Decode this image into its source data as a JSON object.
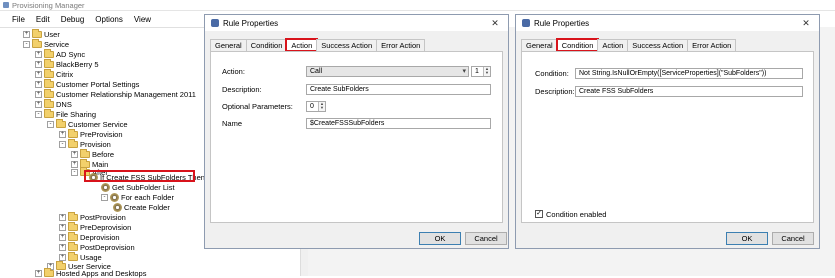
{
  "window": {
    "title": "Provisioning Manager"
  },
  "menu": [
    "File",
    "Edit",
    "Debug",
    "Options",
    "View"
  ],
  "tree": [
    {
      "label": "User",
      "icon": "folder-icon",
      "exp": "+"
    },
    {
      "label": "Service",
      "icon": "folder-icon",
      "exp": "-"
    },
    {
      "label": "AD Sync",
      "icon": "folder-icon",
      "exp": "+"
    },
    {
      "label": "BlackBerry 5",
      "icon": "folder-icon",
      "exp": "+"
    },
    {
      "label": "Citrix",
      "icon": "folder-icon",
      "exp": "+"
    },
    {
      "label": "Customer Portal Settings",
      "icon": "folder-icon",
      "exp": "+"
    },
    {
      "label": "Customer Relationship Management 2011",
      "icon": "folder-icon",
      "exp": "+"
    },
    {
      "label": "DNS",
      "icon": "folder-icon",
      "exp": "+"
    },
    {
      "label": "File Sharing",
      "icon": "folder-icon",
      "exp": "-"
    },
    {
      "label": "Customer Service",
      "icon": "folder-icon",
      "exp": "-"
    },
    {
      "label": "PreProvision",
      "icon": "folder-icon",
      "exp": "+"
    },
    {
      "label": "Provision",
      "icon": "folder-icon",
      "exp": "-"
    },
    {
      "label": "Before",
      "icon": "folder-icon",
      "exp": "+"
    },
    {
      "label": "Main",
      "icon": "folder-icon",
      "exp": "+"
    },
    {
      "label": "After",
      "icon": "folder-icon",
      "exp": "-"
    },
    {
      "label": "If Create FSS SubFolders Then",
      "icon": "rule-icon",
      "exp": "-"
    },
    {
      "label": "Get SubFolder List",
      "icon": "gear-icon",
      "exp": ""
    },
    {
      "label": "For each Folder",
      "icon": "gear-icon",
      "exp": "-"
    },
    {
      "label": "Create Folder",
      "icon": "gear-icon",
      "exp": ""
    },
    {
      "label": "PostProvision",
      "icon": "folder-icon",
      "exp": "+"
    },
    {
      "label": "PreDeprovision",
      "icon": "folder-icon",
      "exp": "+"
    },
    {
      "label": "Deprovision",
      "icon": "folder-icon",
      "exp": "+"
    },
    {
      "label": "PostDeprovision",
      "icon": "folder-icon",
      "exp": "+"
    },
    {
      "label": "Usage",
      "icon": "folder-icon",
      "exp": "+"
    },
    {
      "label": "User Service",
      "icon": "folder-icon",
      "exp": "+"
    },
    {
      "label": "Hosted Apps and Desktops",
      "icon": "folder-icon",
      "exp": "+"
    }
  ],
  "dialog_action": {
    "title": "Rule Properties",
    "tabs": [
      "General",
      "Condition",
      "Action",
      "Success Action",
      "Error Action"
    ],
    "active_tab": "Action",
    "action_label": "Action:",
    "action_value": "Call",
    "action_count": "1",
    "description_label": "Description:",
    "description_value": "Create SubFolders",
    "optional_label": "Optional Parameters:",
    "optional_value": "0",
    "name_label": "Name",
    "name_value": "$CreateFSSSubFolders",
    "ok": "OK",
    "cancel": "Cancel"
  },
  "dialog_condition": {
    "title": "Rule Properties",
    "tabs": [
      "General",
      "Condition",
      "Action",
      "Success Action",
      "Error Action"
    ],
    "active_tab": "Condition",
    "condition_label": "Condition:",
    "condition_value": "Not String.IsNullOrEmpty([ServiceProperties](\"SubFolders\"))",
    "description_label": "Description:",
    "description_value": "Create FSS SubFolders",
    "enabled_label": "Condition enabled",
    "enabled": true,
    "ok": "OK",
    "cancel": "Cancel"
  },
  "colors": {
    "highlight_red": "#d8131b",
    "folder": "#f2d06b"
  }
}
